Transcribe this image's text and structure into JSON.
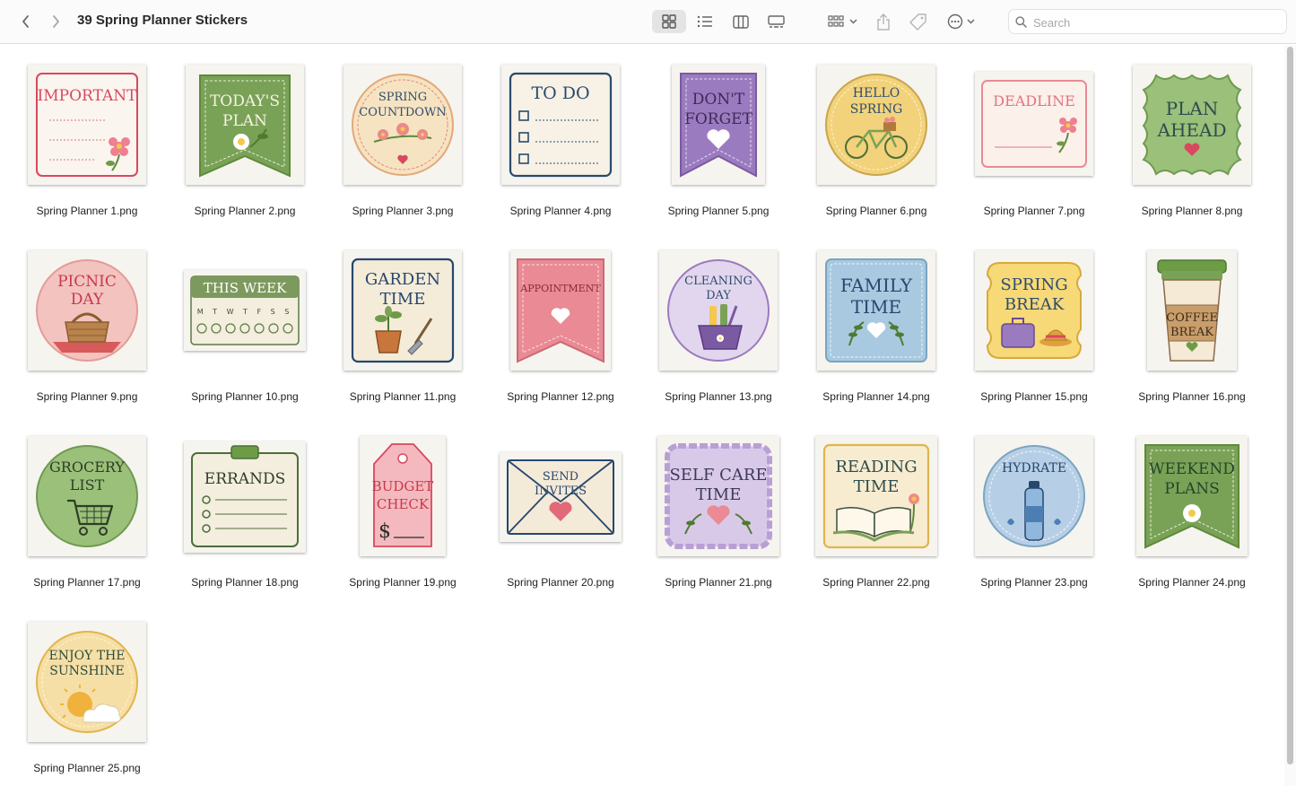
{
  "window": {
    "title": "39 Spring Planner Stickers"
  },
  "search": {
    "placeholder": "Search"
  },
  "toolbar": {
    "icons": [
      "chevron-left-icon",
      "chevron-right-icon",
      "icon-view-icon",
      "list-view-icon",
      "column-view-icon",
      "gallery-view-icon",
      "group-icon",
      "share-icon",
      "tag-icon",
      "more-icon",
      "search-icon"
    ]
  },
  "colors": {
    "accent": "#e4e4e4",
    "red": "#d9485f",
    "green": "#7aa257",
    "purple": "#9b7bbf",
    "blue": "#27476e",
    "yellow": "#f2d27a",
    "pink": "#e98a94"
  },
  "files": [
    {
      "name": "Spring Planner 1.png",
      "lines": [
        "IMPORTANT"
      ]
    },
    {
      "name": "Spring Planner 2.png",
      "lines": [
        "TODAY'S",
        "PLAN"
      ]
    },
    {
      "name": "Spring Planner 3.png",
      "lines": [
        "SPRING",
        "COUNTDOWN"
      ]
    },
    {
      "name": "Spring Planner 4.png",
      "lines": [
        "TO DO"
      ]
    },
    {
      "name": "Spring Planner 5.png",
      "lines": [
        "DON'T",
        "FORGET"
      ]
    },
    {
      "name": "Spring Planner 6.png",
      "lines": [
        "HELLO",
        "SPRING"
      ]
    },
    {
      "name": "Spring Planner 7.png",
      "lines": [
        "DEADLINE"
      ]
    },
    {
      "name": "Spring Planner 8.png",
      "lines": [
        "PLAN",
        "AHEAD"
      ]
    },
    {
      "name": "Spring Planner 9.png",
      "lines": [
        "PICNIC",
        "DAY"
      ]
    },
    {
      "name": "Spring Planner 10.png",
      "lines": [
        "THIS WEEK"
      ],
      "days": "M T W T F S S"
    },
    {
      "name": "Spring Planner 11.png",
      "lines": [
        "GARDEN",
        "TIME"
      ]
    },
    {
      "name": "Spring Planner 12.png",
      "lines": [
        "APPOINTMENT"
      ]
    },
    {
      "name": "Spring Planner 13.png",
      "lines": [
        "CLEANING",
        "DAY"
      ]
    },
    {
      "name": "Spring Planner 14.png",
      "lines": [
        "FAMILY",
        "TIME"
      ]
    },
    {
      "name": "Spring Planner 15.png",
      "lines": [
        "SPRING",
        "BREAK"
      ]
    },
    {
      "name": "Spring Planner 16.png",
      "lines": [
        "COFFEE",
        "BREAK"
      ]
    },
    {
      "name": "Spring Planner 17.png",
      "lines": [
        "GROCERY",
        "LIST"
      ]
    },
    {
      "name": "Spring Planner 18.png",
      "lines": [
        "ERRANDS"
      ]
    },
    {
      "name": "Spring Planner 19.png",
      "lines": [
        "BUDGET",
        "CHECK",
        "$"
      ]
    },
    {
      "name": "Spring Planner 20.png",
      "lines": [
        "SEND",
        "INVITES"
      ]
    },
    {
      "name": "Spring Planner 21.png",
      "lines": [
        "SELF CARE",
        "TIME"
      ]
    },
    {
      "name": "Spring Planner 22.png",
      "lines": [
        "READING",
        "TIME"
      ]
    },
    {
      "name": "Spring Planner 23.png",
      "lines": [
        "HYDRATE"
      ]
    },
    {
      "name": "Spring Planner 24.png",
      "lines": [
        "WEEKEND",
        "PLANS"
      ]
    },
    {
      "name": "Spring Planner 25.png",
      "lines": [
        "ENJOY THE",
        "SUNSHINE"
      ]
    }
  ]
}
